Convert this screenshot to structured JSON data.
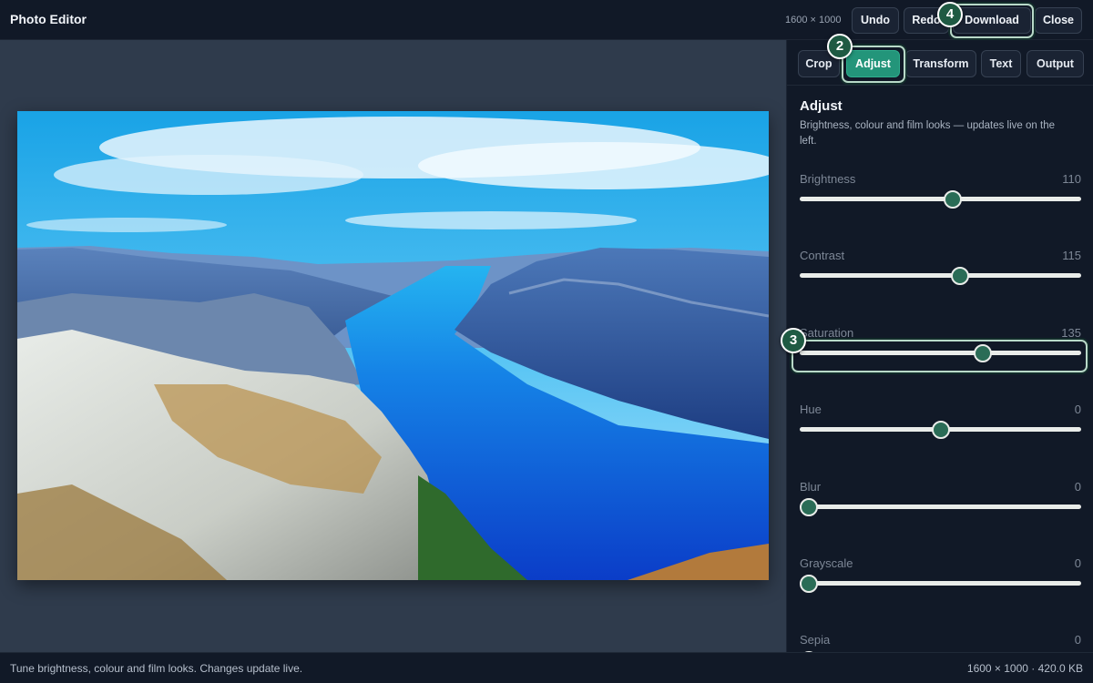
{
  "app": {
    "title": "Photo Editor"
  },
  "topbar": {
    "dimensions": "1600 × 1000",
    "undo_label": "Undo",
    "redo_label": "Redo",
    "download_label": "Download",
    "close_label": "Close"
  },
  "tabs": [
    {
      "label": "Crop",
      "active": false
    },
    {
      "label": "Adjust",
      "active": true
    },
    {
      "label": "Transform",
      "active": false
    },
    {
      "label": "Text",
      "active": false
    },
    {
      "label": "Output",
      "active": false
    }
  ],
  "panel": {
    "heading": "Adjust",
    "description": "Brightness, colour and film looks — updates live on the left.",
    "sliders": [
      {
        "label": "Brightness",
        "value": "110",
        "fraction": 0.548
      },
      {
        "label": "Contrast",
        "value": "115",
        "fraction": 0.573
      },
      {
        "label": "Saturation",
        "value": "135",
        "fraction": 0.66
      },
      {
        "label": "Hue",
        "value": "0",
        "fraction": 0.5
      },
      {
        "label": "Blur",
        "value": "0",
        "fraction": 0.0
      },
      {
        "label": "Grayscale",
        "value": "0",
        "fraction": 0.0
      },
      {
        "label": "Sepia",
        "value": "0",
        "fraction": 0.0
      }
    ]
  },
  "statusbar": {
    "message": "Tune brightness, colour and film looks. Changes update live.",
    "info": "1600 × 1000 · 420.0 KB"
  },
  "annotations": [
    {
      "number": "2",
      "target": "tab-adjust"
    },
    {
      "number": "3",
      "target": "saturation-slider"
    },
    {
      "number": "4",
      "target": "download-button"
    }
  ],
  "colors": {
    "accent": "#23957a",
    "highlight_border": "#b8d9c8",
    "badge_fill": "#1f5a43",
    "slider_thumb": "#2a6c56"
  },
  "image": {
    "subject": "fjord-landscape-photo"
  }
}
